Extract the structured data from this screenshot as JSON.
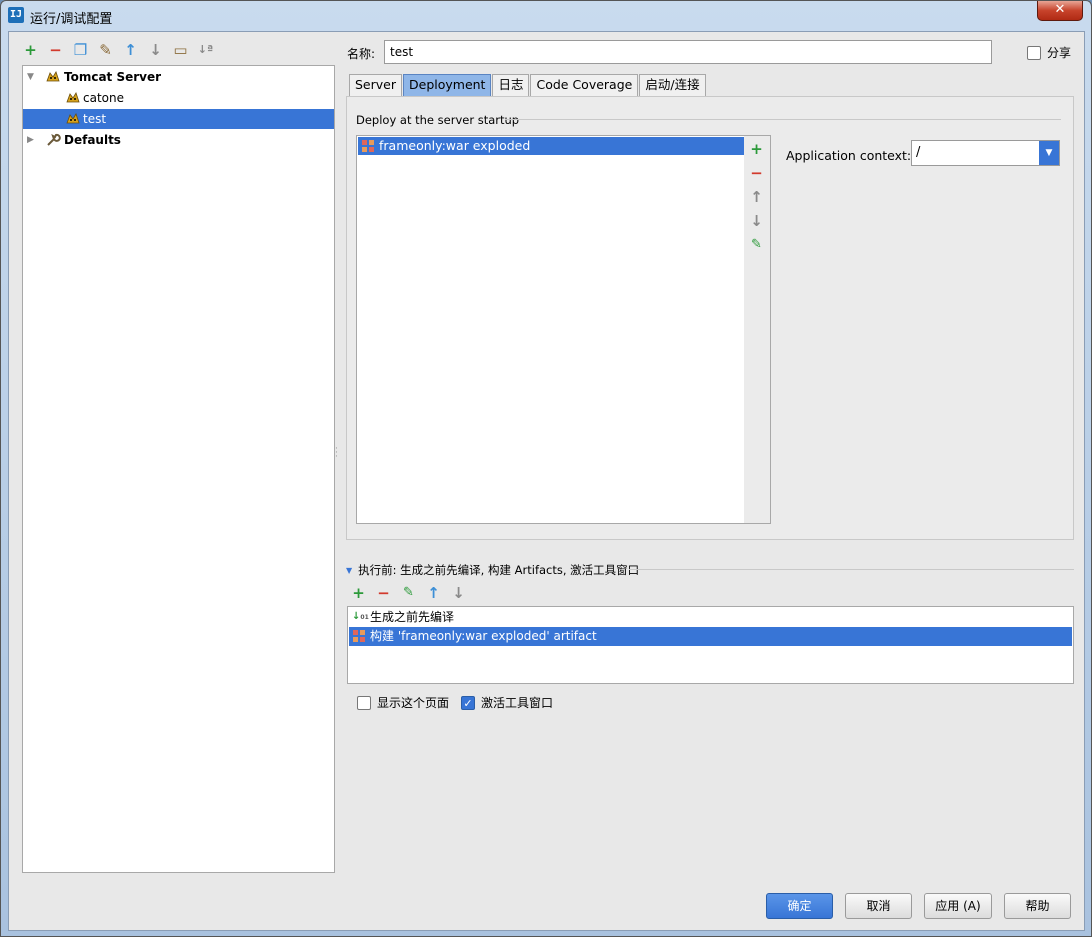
{
  "window": {
    "title": "运行/调试配置",
    "icon_text": "IJ"
  },
  "left_toolbar": {
    "icons": [
      "add-icon",
      "remove-icon",
      "copy-icon",
      "edit-defaults-icon",
      "move-up-icon",
      "move-down-icon",
      "folder-icon",
      "sort-icon"
    ]
  },
  "tree": {
    "items": [
      {
        "label": "Tomcat Server",
        "level": 0,
        "expanded": true
      },
      {
        "label": "catone",
        "level": 1
      },
      {
        "label": "test",
        "level": 1,
        "selected": true
      },
      {
        "label": "Defaults",
        "level": 0,
        "expanded": false
      }
    ]
  },
  "name_field": {
    "label": "名称:",
    "value": "test"
  },
  "share": {
    "label": "分享",
    "checked": false
  },
  "tabs": [
    {
      "label": "Server"
    },
    {
      "label": "Deployment",
      "active": true
    },
    {
      "label": "日志"
    },
    {
      "label": "Code Coverage"
    },
    {
      "label": "启动/连接"
    }
  ],
  "deployment": {
    "group_title": "Deploy at the server startup",
    "items": [
      {
        "label": "frameonly:war exploded",
        "selected": true
      }
    ],
    "context_label": "Application context:",
    "context_value": "/"
  },
  "before_launch": {
    "title": "执行前: 生成之前先编译, 构建 Artifacts, 激活工具窗口",
    "items": [
      {
        "label": "生成之前先编译",
        "selected": false
      },
      {
        "label": "构建 'frameonly:war exploded' artifact",
        "selected": true
      }
    ]
  },
  "options": {
    "show_page": {
      "label": "显示这个页面",
      "checked": false
    },
    "activate_tool": {
      "label": "激活工具窗口",
      "checked": true
    }
  },
  "buttons": {
    "ok": "确定",
    "cancel": "取消",
    "apply": "应用 (A)",
    "help": "帮助"
  },
  "colors": {
    "selection": "#3875d6",
    "green": "#2c9a3a",
    "red": "#d23a2d"
  }
}
